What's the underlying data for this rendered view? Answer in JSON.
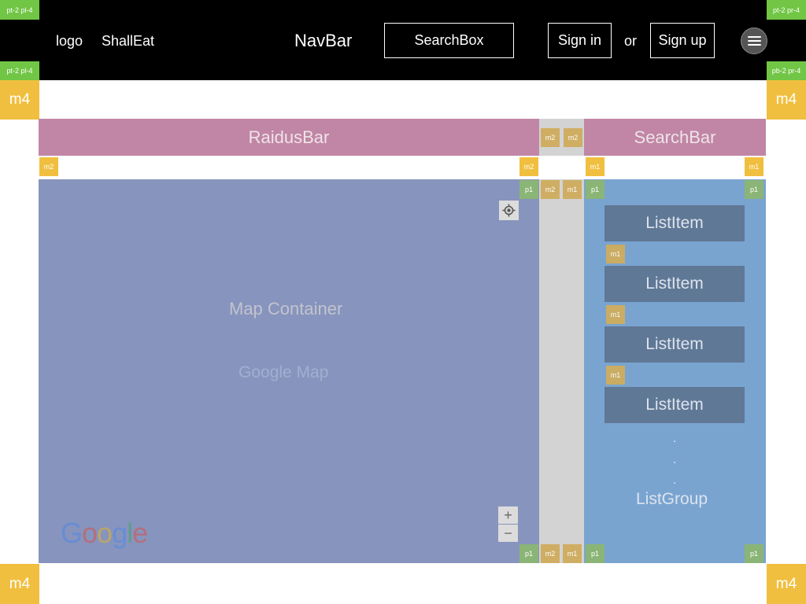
{
  "navbar": {
    "logo": "logo",
    "brand": "ShallEat",
    "title": "NavBar",
    "search_box": "SearchBox",
    "sign_in": "Sign in",
    "or": "or",
    "sign_up": "Sign up",
    "menu_icon": "hamburger-menu-icon"
  },
  "spacing_tags": {
    "top_left": "pt-2 pl-4",
    "top_right": "pt-2 pr-4",
    "bottom_left": "pt-2 pl-4",
    "bottom_right": "pb-2 pr-4",
    "m4": "m4",
    "m2": "m2",
    "m1": "m1",
    "p1": "p1"
  },
  "bars": {
    "radius_bar": "RaidusBar",
    "search_bar": "SearchBar"
  },
  "map": {
    "container_label": "Map Container",
    "google_map_label": "Google Map",
    "google_letters": [
      "G",
      "o",
      "o",
      "g",
      "l",
      "e"
    ],
    "google_colors": [
      "#4285F4",
      "#EA4335",
      "#FBBC05",
      "#4285F4",
      "#34A853",
      "#EA4335"
    ],
    "zoom_in": "+",
    "zoom_out": "−",
    "locate_icon": "crosshair-icon"
  },
  "list": {
    "items": [
      "ListItem",
      "ListItem",
      "ListItem",
      "ListItem"
    ],
    "dots": [
      ".",
      ".",
      "."
    ],
    "group_label": "ListGroup"
  },
  "colors": {
    "navbar": "#000000",
    "bar": "#c186a5",
    "map": "#8794bd",
    "list_group": "#7aa4d0",
    "list_item": "#5f7896",
    "gutter": "#d3d3d3",
    "tag_margin": "#f1bf3f",
    "tag_padding": "#71c645"
  }
}
